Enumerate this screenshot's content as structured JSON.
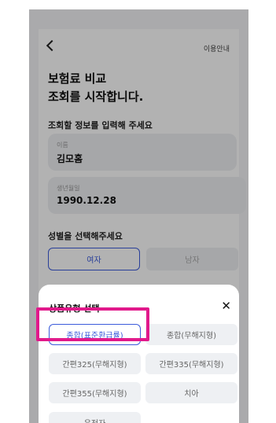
{
  "header": {
    "help_label": "이용안내"
  },
  "title": {
    "line1": "보험료 비교",
    "line2": "조회를 시작합니다."
  },
  "info_section": {
    "label": "조회할 정보를 입력해 주세요"
  },
  "fields": {
    "name": {
      "label": "이름",
      "value": "김모홈"
    },
    "birth": {
      "label": "생년월일",
      "value": "1990.12.28"
    }
  },
  "gender": {
    "label": "성별을 선택해주세요",
    "female": "여자",
    "male": "남자",
    "selected": "여자"
  },
  "sheet": {
    "title": "상품유형 선택",
    "options": [
      {
        "label": "종합(표준환급률)",
        "selected": true
      },
      {
        "label": "종합(무해지형)",
        "selected": false
      },
      {
        "label": "간편325(무해지형)",
        "selected": false
      },
      {
        "label": "간편335(무해지형)",
        "selected": false
      },
      {
        "label": "간편355(무해지형)",
        "selected": false
      },
      {
        "label": "치아",
        "selected": false
      },
      {
        "label": "운전자",
        "selected": false
      }
    ]
  },
  "colors": {
    "accent": "#3b5bdb",
    "highlight": "#e1198b",
    "field_bg": "#eef0f3"
  },
  "icons": {
    "back": "chevron-left-icon",
    "close": "close-icon"
  }
}
